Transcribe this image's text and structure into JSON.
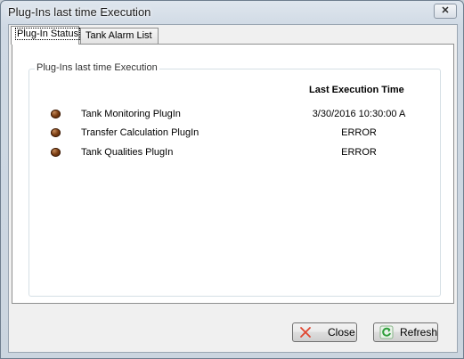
{
  "window": {
    "title": "Plug-Ins last time Execution",
    "close_glyph": "✕"
  },
  "tabs": [
    {
      "label": "Plug-In Status",
      "active": true
    },
    {
      "label": "Tank Alarm List",
      "active": false
    }
  ],
  "group": {
    "title": "Plug-Ins last time Execution",
    "column_header": "Last Execution Time",
    "rows": [
      {
        "name": "Tank Monitoring PlugIn",
        "time": "3/30/2016  10:30:00  A",
        "status_icon": "status-led-icon"
      },
      {
        "name": "Transfer Calculation PlugIn",
        "time": "ERROR",
        "status_icon": "status-led-icon"
      },
      {
        "name": "Tank Qualities PlugIn",
        "time": "ERROR",
        "status_icon": "status-led-icon"
      }
    ]
  },
  "buttons": {
    "close_label": "Close",
    "refresh_label": "Refresh"
  },
  "colors": {
    "close_icon": "#e0452f",
    "refresh_icon": "#2e9e3a",
    "status_led": "#6b3410"
  }
}
